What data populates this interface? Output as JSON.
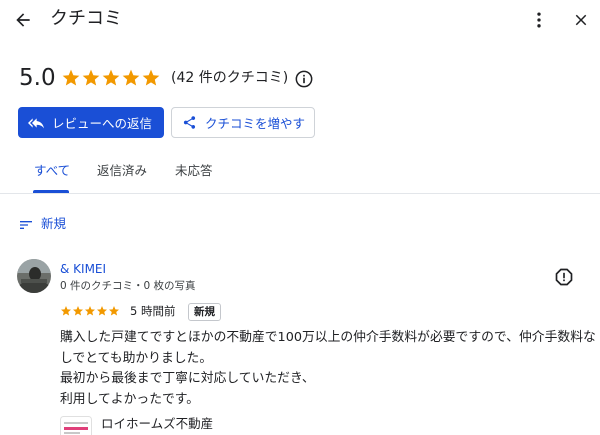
{
  "header": {
    "title": "クチコミ",
    "icons": {
      "back": "arrow-back-icon",
      "more": "more-vert-icon",
      "close": "close-icon"
    }
  },
  "summary": {
    "rating": "5.0",
    "stars": 5,
    "review_count_text": "(42 件のクチコミ)",
    "info_icon": "info-icon"
  },
  "actions": {
    "reply_label": "レビューへの返信",
    "more_reviews_label": "クチコミを増やす"
  },
  "tabs": [
    {
      "label": "すべて",
      "active": true
    },
    {
      "label": "返信済み",
      "active": false
    },
    {
      "label": "未応答",
      "active": false
    }
  ],
  "sort": {
    "label": "新規",
    "icon": "sort-icon"
  },
  "review": {
    "name": "& KIMEI",
    "meta": "0 件のクチコミ・0 枚の写真",
    "stars": 5,
    "time": "5 時間前",
    "badge": "新規",
    "text_lines": [
      "購入した戸建てですとほかの不動産で100万以上の仲介手数料が必要ですので、仲介手数料な",
      "しでとても助かりました。",
      "最初から最後まで丁寧に対応していただき、",
      "利用してよかったです。"
    ]
  },
  "owner_reply": {
    "name": "ロイホームズ不動産"
  },
  "colors": {
    "accent": "#1a4fd6",
    "star": "#f29900",
    "review_star": "#f29900",
    "text": "#202124"
  }
}
